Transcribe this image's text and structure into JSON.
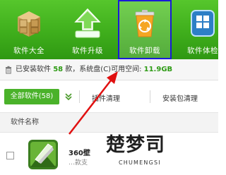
{
  "toolbar": {
    "items": [
      {
        "label": "软件大全",
        "icon": "software-box-icon"
      },
      {
        "label": "软件升级",
        "icon": "upgrade-arrow-icon"
      },
      {
        "label": "软件卸载",
        "icon": "recycle-bin-icon",
        "selected": true
      },
      {
        "label": "软件体检",
        "icon": "checkup-icon"
      }
    ]
  },
  "info": {
    "prefix": "已安装软件",
    "count": "58",
    "mid": "款，系统盘(C)可用空间:",
    "space": "11.9GB"
  },
  "filters": {
    "all_label": "全部软件(58)",
    "plugin_label": "插件清理",
    "package_label": "安装包清理"
  },
  "table": {
    "header_name": "软件名称",
    "rows": [
      {
        "name": "360壁",
        "sub": "…款支"
      }
    ]
  },
  "watermark": {
    "big": "楚梦司",
    "small": "CHUMENGSI"
  },
  "colors": {
    "toolbar_green": "#3fae1c",
    "accent_green": "#2e9b15",
    "selection_border": "#1a1ad8",
    "annotation_red": "#e01010"
  }
}
